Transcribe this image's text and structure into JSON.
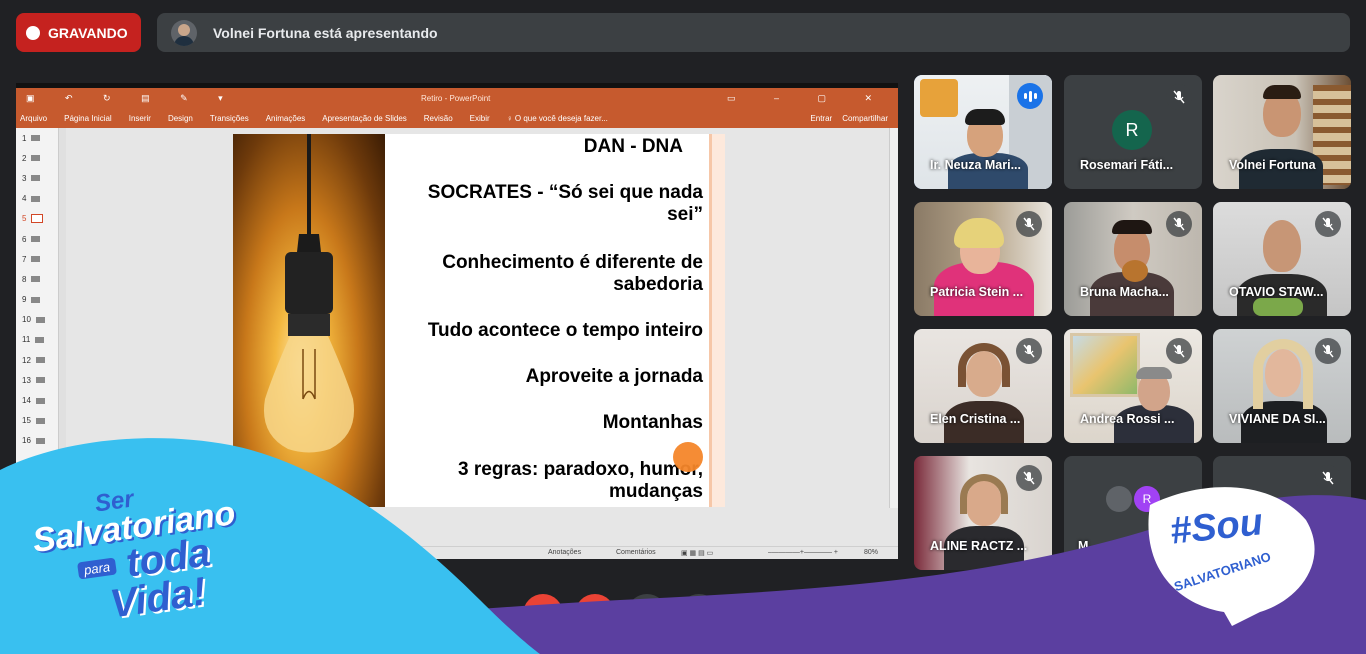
{
  "recording": {
    "label": "GRAVANDO",
    "color": "#c5221f"
  },
  "presenter": {
    "text": "Volnei Fortuna está apresentando"
  },
  "powerpoint": {
    "window_title": "Retiro - PowerPoint",
    "menu": [
      "Arquivo",
      "Página Inicial",
      "Inserir",
      "Design",
      "Transições",
      "Animações",
      "Apresentação de Slides",
      "Revisão",
      "Exibir",
      "♀ O que você deseja fazer..."
    ],
    "menu_right": [
      "Entrar",
      "Compartilhar"
    ],
    "thumbnails": [
      "1",
      "2",
      "3",
      "4",
      "5",
      "6",
      "7",
      "8",
      "9",
      "10",
      "11",
      "12",
      "13",
      "14",
      "15",
      "16"
    ],
    "active_thumbnail": "5",
    "slide_lines": [
      "DAN -   DNA",
      "SOCRATES - “Só sei que nada\nsei”",
      "Conhecimento é diferente de\nsabedoria ",
      "Tudo acontece o tempo inteiro",
      "Aproveite a jornada",
      "Montanhas",
      "3 regras: paradoxo, humor,\nmudanças"
    ],
    "status": {
      "notes": "Anotações",
      "comments": "Comentários",
      "zoom": "80%"
    }
  },
  "participants": [
    {
      "name": "Ir. Neuza Mari...",
      "speaking": true
    },
    {
      "name": "Rosemari Fáti...",
      "muted": true,
      "avatar_letter": "R"
    },
    {
      "name": "Volnei Fortuna"
    },
    {
      "name": "Patricia Stein ...",
      "muted": true
    },
    {
      "name": "Bruna Macha...",
      "muted": true
    },
    {
      "name": "OTAVIO STAW...",
      "muted": true
    },
    {
      "name": "Elen Cristina ...",
      "muted": true
    },
    {
      "name": "Andrea Rossi ...",
      "muted": true
    },
    {
      "name": "VIVIANE DA SI...",
      "muted": true
    },
    {
      "name": "ALINE RACTZ ...",
      "muted": true
    },
    {
      "name": "M...",
      "muted": false,
      "avatar_letter": "R"
    },
    {
      "name": "",
      "muted": true
    }
  ],
  "branding": {
    "left_line1": "Ser",
    "left_line2": "Salvatoriano",
    "left_para": "para",
    "left_toda": "toda",
    "left_vida": "Vida!",
    "right_hashtag": "#Sou",
    "right_word": "SALVATORIANO"
  },
  "colors": {
    "accent_blue": "#8ab4f8",
    "ppt_orange": "#c65a2e",
    "wave_purple": "#5b3fa0",
    "wave_cyan": "#39c0f0",
    "brand_text_blue": "#2f5fd0"
  }
}
